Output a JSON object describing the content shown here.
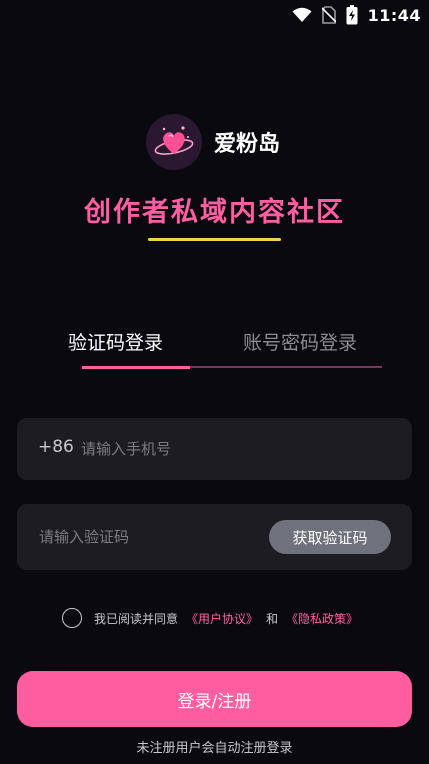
{
  "status_bar": {
    "time": "11:44",
    "icons": [
      "wifi-icon",
      "no-sim-icon",
      "battery-charging-icon"
    ]
  },
  "brand": {
    "app_name": "爱粉岛",
    "logo_icon": "heart-planet-icon"
  },
  "slogan": "创作者私域内容社区",
  "tabs": [
    {
      "label": "验证码登录",
      "active": true
    },
    {
      "label": "账号密码登录",
      "active": false
    }
  ],
  "phone_field": {
    "country_code": "+86",
    "placeholder": "请输入手机号",
    "value": ""
  },
  "code_field": {
    "placeholder": "请输入验证码",
    "value": "",
    "get_code_label": "获取验证码"
  },
  "agreement": {
    "checked": false,
    "prefix": "我已阅读并同意",
    "user_agreement": "《用户协议》",
    "conjunction": "和",
    "privacy_policy": "《隐私政策》"
  },
  "login_button_label": "登录/注册",
  "login_hint": "未注册用户会自动注册登录",
  "colors": {
    "background": "#0b0910",
    "accent_pink": "#ff5fa2",
    "underline_yellow": "#f2d24b",
    "field_background": "#1d1c22",
    "button_gray": "#6f717c"
  }
}
